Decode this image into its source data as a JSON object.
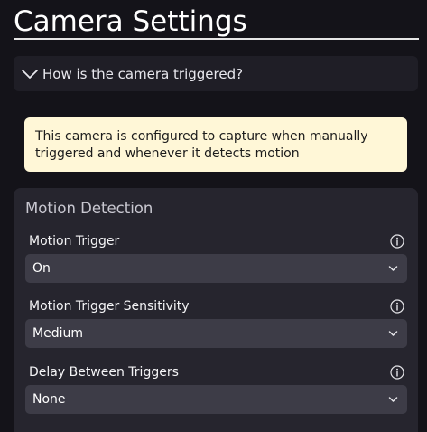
{
  "page": {
    "title": "Camera Settings"
  },
  "accordion": {
    "label": "How is the camera triggered?",
    "icon": "chevron-down-icon"
  },
  "info_box": {
    "text": "This camera is configured to capture when manually triggered and whenever it detects motion"
  },
  "motion_detection": {
    "title": "Motion Detection",
    "fields": [
      {
        "label": "Motion Trigger",
        "value": "On"
      },
      {
        "label": "Motion Trigger Sensitivity",
        "value": "Medium"
      },
      {
        "label": "Delay Between Triggers",
        "value": "None"
      }
    ]
  },
  "colors": {
    "background": "#141319",
    "panel": "#26252e",
    "select": "#3d3c47",
    "info_box": "#fff7d7",
    "accordion": "#1f1e26"
  }
}
